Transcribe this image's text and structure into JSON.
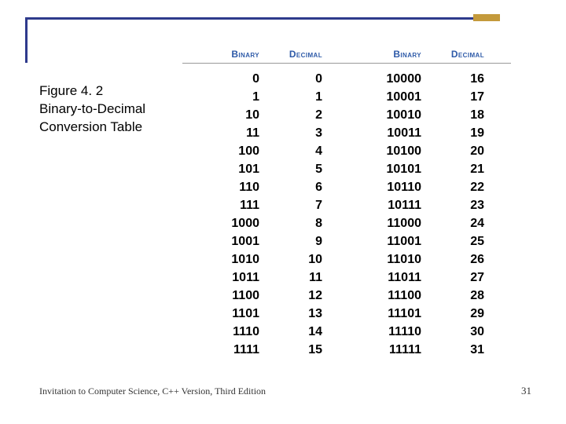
{
  "caption": {
    "line1": "Figure 4. 2",
    "line2": "Binary-to-Decimal",
    "line3": "Conversion Table"
  },
  "headers": {
    "binary1": "Binary",
    "decimal1": "Decimal",
    "binary2": "Binary",
    "decimal2": "Decimal"
  },
  "rows": [
    {
      "b1": "0",
      "d1": "0",
      "b2": "10000",
      "d2": "16"
    },
    {
      "b1": "1",
      "d1": "1",
      "b2": "10001",
      "d2": "17"
    },
    {
      "b1": "10",
      "d1": "2",
      "b2": "10010",
      "d2": "18"
    },
    {
      "b1": "11",
      "d1": "3",
      "b2": "10011",
      "d2": "19"
    },
    {
      "b1": "100",
      "d1": "4",
      "b2": "10100",
      "d2": "20"
    },
    {
      "b1": "101",
      "d1": "5",
      "b2": "10101",
      "d2": "21"
    },
    {
      "b1": "110",
      "d1": "6",
      "b2": "10110",
      "d2": "22"
    },
    {
      "b1": "111",
      "d1": "7",
      "b2": "10111",
      "d2": "23"
    },
    {
      "b1": "1000",
      "d1": "8",
      "b2": "11000",
      "d2": "24"
    },
    {
      "b1": "1001",
      "d1": "9",
      "b2": "11001",
      "d2": "25"
    },
    {
      "b1": "1010",
      "d1": "10",
      "b2": "11010",
      "d2": "26"
    },
    {
      "b1": "1011",
      "d1": "11",
      "b2": "11011",
      "d2": "27"
    },
    {
      "b1": "1100",
      "d1": "12",
      "b2": "11100",
      "d2": "28"
    },
    {
      "b1": "1101",
      "d1": "13",
      "b2": "11101",
      "d2": "29"
    },
    {
      "b1": "1110",
      "d1": "14",
      "b2": "11110",
      "d2": "30"
    },
    {
      "b1": "1111",
      "d1": "15",
      "b2": "11111",
      "d2": "31"
    }
  ],
  "footer": "Invitation to Computer Science, C++ Version, Third Edition",
  "page_number": "31",
  "chart_data": {
    "type": "table",
    "title": "Figure 4.2 Binary-to-Decimal Conversion Table",
    "columns": [
      "Binary",
      "Decimal"
    ],
    "data": [
      [
        "0",
        0
      ],
      [
        "1",
        1
      ],
      [
        "10",
        2
      ],
      [
        "11",
        3
      ],
      [
        "100",
        4
      ],
      [
        "101",
        5
      ],
      [
        "110",
        6
      ],
      [
        "111",
        7
      ],
      [
        "1000",
        8
      ],
      [
        "1001",
        9
      ],
      [
        "1010",
        10
      ],
      [
        "1011",
        11
      ],
      [
        "1100",
        12
      ],
      [
        "1101",
        13
      ],
      [
        "1110",
        14
      ],
      [
        "1111",
        15
      ],
      [
        "10000",
        16
      ],
      [
        "10001",
        17
      ],
      [
        "10010",
        18
      ],
      [
        "10011",
        19
      ],
      [
        "10100",
        20
      ],
      [
        "10101",
        21
      ],
      [
        "10110",
        22
      ],
      [
        "10111",
        23
      ],
      [
        "11000",
        24
      ],
      [
        "11001",
        25
      ],
      [
        "11010",
        26
      ],
      [
        "11011",
        27
      ],
      [
        "11100",
        28
      ],
      [
        "11101",
        29
      ],
      [
        "11110",
        30
      ],
      [
        "11111",
        31
      ]
    ]
  }
}
